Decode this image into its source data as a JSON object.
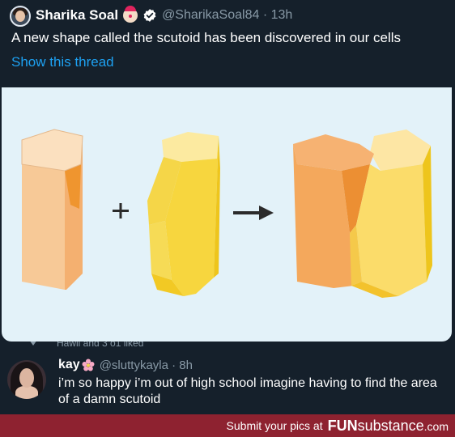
{
  "tweet1": {
    "display_name": "Sharika Soal",
    "handle_time": "@SharikaSoal84 · 13h",
    "text": "A new shape called the scutoid has been discovered in our cells",
    "show_thread": "Show this thread",
    "icons": [
      "avatar",
      "clown-emoji-icon",
      "verified-icon"
    ]
  },
  "image": {
    "plus_symbol": "+",
    "colors": {
      "background": "#e3f2f9",
      "orange_light": "#fad8b0",
      "orange_mid": "#f4a85c",
      "orange_dark": "#ec8f33",
      "yellow_light": "#fbe58a",
      "yellow_mid": "#f7d43b",
      "yellow_dark": "#eec51c",
      "arrow": "#2b2b2b"
    }
  },
  "liked_strip": {
    "text": "Hawii and 3 o1 liked"
  },
  "tweet2": {
    "display_name": "kay",
    "handle_time": "@sluttykayla · 8h",
    "text": "i’m so happy i’m out of high school imagine having to find the area of a damn scutoid",
    "icons": [
      "avatar",
      "flower-emoji-icon"
    ]
  },
  "footer": {
    "prefix": "Submit your pics at",
    "brand_bold": "FUN",
    "brand_rest": "substance",
    "brand_suffix": ".com"
  },
  "colors": {
    "page_bg": "#15202b",
    "text": "#ffffff",
    "muted": "#8899a6",
    "link": "#1da1f2",
    "footer_bg": "#8e2230"
  }
}
